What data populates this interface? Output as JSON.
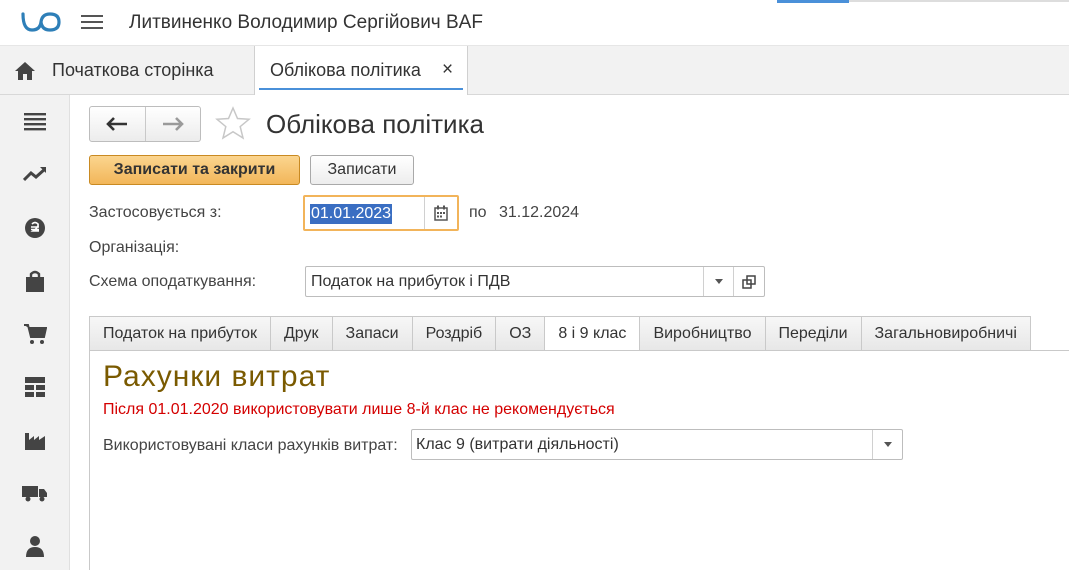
{
  "app": {
    "title": "Литвиненко Володимир Сергійович BAF"
  },
  "tabs_bar": {
    "home_label": "Початкова сторінка",
    "doc_label": "Облікова політика",
    "close_glyph": "×"
  },
  "sidebar": {
    "items": [
      "menu-icon",
      "trend-icon",
      "currency-icon",
      "bag-icon",
      "cart-icon",
      "warehouse-icon",
      "factory-icon",
      "truck-icon",
      "person-icon"
    ]
  },
  "form": {
    "title": "Облікова політика",
    "save_close_label": "Записати та закрити",
    "save_label": "Записати",
    "applies_from_label": "Застосовується з:",
    "applies_from_value": "01.01.2023",
    "to_label": "по",
    "to_value": "31.12.2024",
    "organization_label": "Організація:",
    "tax_scheme_label": "Схема оподаткування:",
    "tax_scheme_value": "Податок на прибуток і ПДВ"
  },
  "tabs": [
    "Податок на прибуток",
    "Друк",
    "Запаси",
    "Роздріб",
    "ОЗ",
    "8 і 9 клас",
    "Виробництво",
    "Переділи",
    "Загальновиробничі"
  ],
  "active_tab_index": 5,
  "panel": {
    "section_title": "Рахунки витрат",
    "warning": "Після 01.01.2020 використовувати лише 8-й клас не рекомендується",
    "classes_label": "Використовувані класи рахунків витрат:",
    "classes_value": "Клас 9 (витрати діяльності)"
  },
  "colors": {
    "accent_blue": "#4a90d9",
    "primary_button": "#f2b659",
    "title_brown": "#7a5a00",
    "warning_red": "#d40000",
    "selection": "#3a6ec2"
  }
}
